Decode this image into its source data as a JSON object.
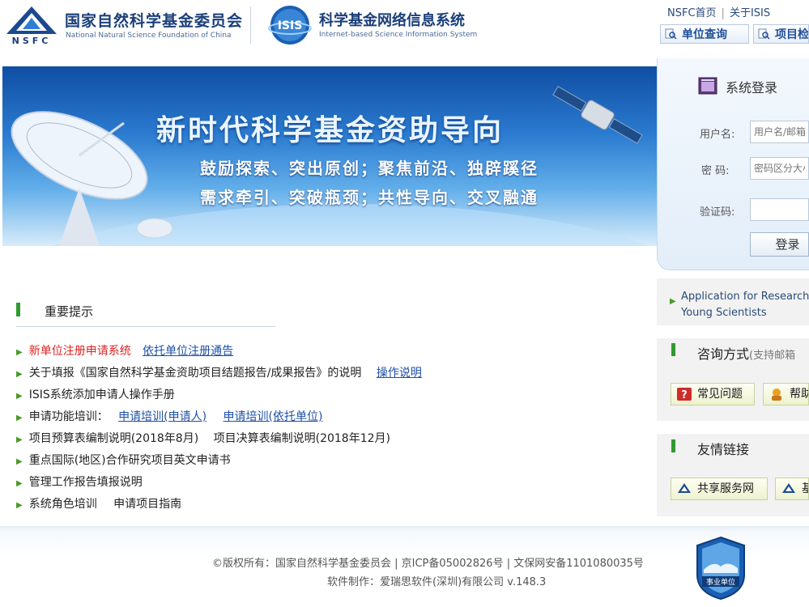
{
  "header": {
    "org_cn": "国家自然科学基金委员会",
    "org_en": "National Natural Science Foundation of China",
    "nsfc_logo_text": "NSFC",
    "isis_logo_text": "ISIS",
    "system_cn": "科学基金网络信息系统",
    "system_en": "Internet-based Science Information System",
    "links": [
      "NSFC首页",
      "关于ISIS"
    ],
    "link_sep": "|",
    "query_buttons": [
      "单位查询",
      "项目检"
    ]
  },
  "banner": {
    "title": "新时代科学基金资助导向",
    "line1": "鼓励探索、突出原创；聚焦前沿、独辟蹊径",
    "line2": "需求牵引、突破瓶颈；共性导向、交叉融通"
  },
  "login": {
    "title": "系统登录",
    "username_label": "用户名:",
    "username_placeholder": "用户名/邮箱",
    "password_label": "密  码:",
    "password_placeholder": "密码区分大小写",
    "captcha_label": "验证码:",
    "submit_label": "登录"
  },
  "application_box": {
    "line1": "Application for Research",
    "line2": "Young Scientists"
  },
  "consult": {
    "title": "咨询方式",
    "subtitle": "(支持邮箱",
    "buttons": [
      "常见问题",
      "帮助"
    ]
  },
  "friend_links": {
    "title": "友情链接",
    "buttons": [
      "共享服务网",
      "基"
    ]
  },
  "notices": {
    "title": "重要提示",
    "items": [
      {
        "text": "新单位注册申请系统",
        "link": "依托单位注册通告"
      },
      {
        "text": "关于填报《国家自然科学基金资助项目结题报告/成果报告》的说明",
        "link": "操作说明"
      },
      {
        "text": "ISIS系统添加申请人操作手册"
      },
      {
        "text": "申请功能培训：",
        "link": "申请培训(申请人)",
        "link2": "申请培训(依托单位)"
      },
      {
        "text": "项目预算表编制说明(2018年8月)",
        "text2": "项目决算表编制说明(2018年12月)"
      },
      {
        "text": "重点国际(地区)合作研究项目英文申请书"
      },
      {
        "text": "管理工作报告填报说明"
      },
      {
        "text": "系统角色培训",
        "text2": "申请项目指南"
      }
    ]
  },
  "footer": {
    "line1": "©版权所有：国家自然科学基金委员会 | 京ICP备05002826号 | 文保网安备1101080035号",
    "line2": "软件制作：爱瑞思软件(深圳)有限公司 v.148.3",
    "badge_text": "事业单位"
  },
  "colors": {
    "brand_blue": "#1b3f7a",
    "link_blue": "#1e4fa5",
    "accent_green": "#2f9a2f",
    "notice_red": "#e02020"
  },
  "icons": [
    "nsfc-logo",
    "isis-logo",
    "magnifier-icon",
    "login-window-icon",
    "faq-icon",
    "help-icon",
    "share-service-icon",
    "bullet-arrow-icon"
  ]
}
